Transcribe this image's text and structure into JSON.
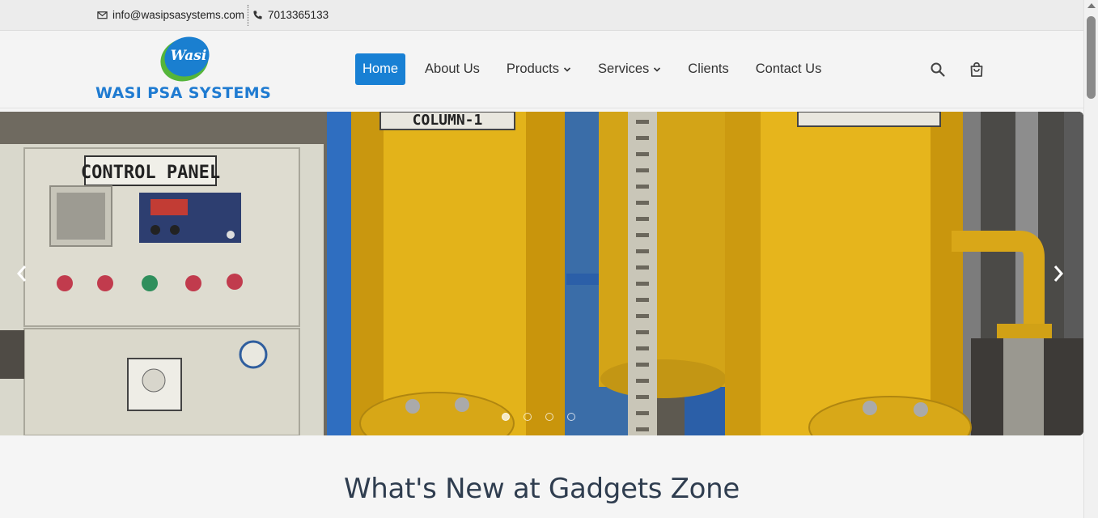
{
  "topbar": {
    "email": "info@wasipsasystems.com",
    "phone": "7013365133",
    "email_icon": "mail-icon",
    "phone_icon": "phone-icon"
  },
  "brand": {
    "logo_script": "Wasi",
    "name": "WASI PSA SYSTEMS"
  },
  "nav": {
    "items": [
      {
        "label": "Home",
        "active": true,
        "dropdown": false
      },
      {
        "label": "About Us",
        "active": false,
        "dropdown": false
      },
      {
        "label": "Products",
        "active": false,
        "dropdown": true
      },
      {
        "label": "Services",
        "active": false,
        "dropdown": true
      },
      {
        "label": "Clients",
        "active": false,
        "dropdown": false
      },
      {
        "label": "Contact Us",
        "active": false,
        "dropdown": false
      }
    ],
    "search_icon": "search-icon",
    "cart_icon": "shopping-bag-icon"
  },
  "hero": {
    "panel_label": "CONTROL PANEL",
    "column_label": "COLUMN-1",
    "slides_total": 4,
    "active_slide": 1,
    "prev_icon": "chevron-left-icon",
    "next_icon": "chevron-right-icon"
  },
  "section": {
    "title": "What's New at Gadgets Zone"
  },
  "colors": {
    "accent": "#1880d4",
    "brand_blue": "#1f7bd1",
    "brand_green": "#55b53a",
    "title": "#2f3d4f"
  }
}
